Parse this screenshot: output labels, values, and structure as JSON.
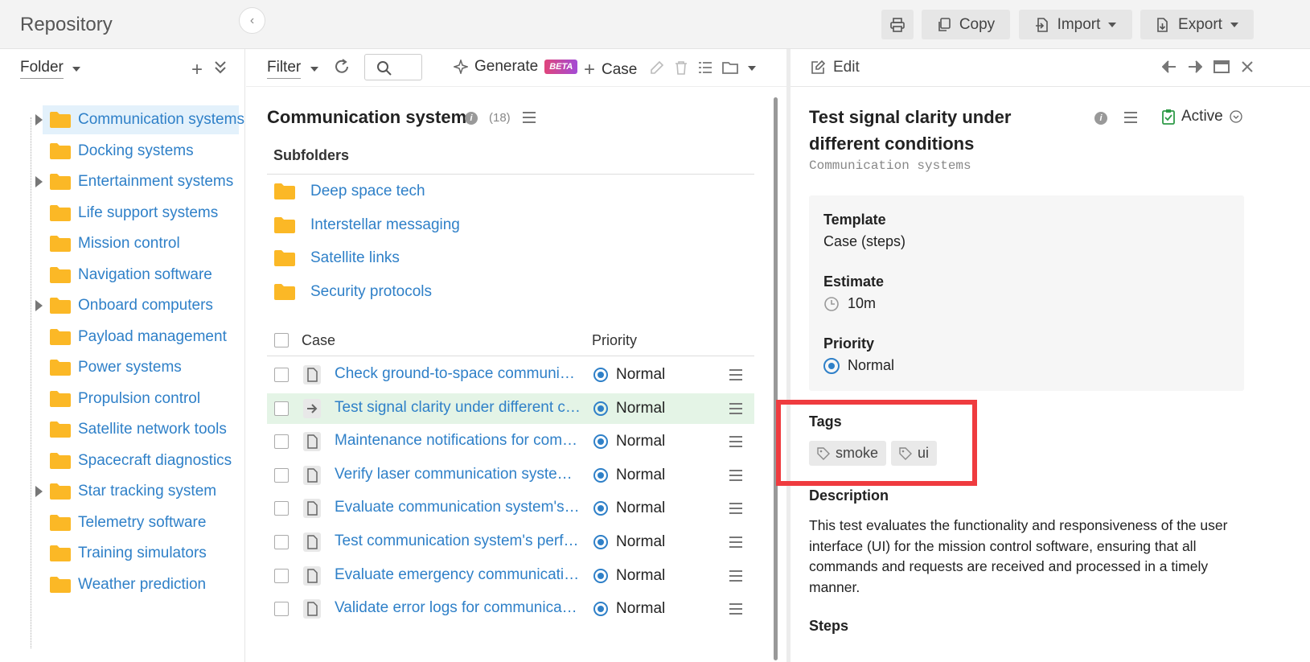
{
  "header": {
    "title": "Repository",
    "buttons": {
      "copy": "Copy",
      "import": "Import",
      "export": "Export"
    }
  },
  "left": {
    "folder_dropdown": "Folder",
    "items": [
      {
        "label": "Communication systems",
        "expandable": true,
        "selected": true
      },
      {
        "label": "Docking systems",
        "expandable": false
      },
      {
        "label": "Entertainment systems",
        "expandable": true
      },
      {
        "label": "Life support systems",
        "expandable": false
      },
      {
        "label": "Mission control",
        "expandable": false
      },
      {
        "label": "Navigation software",
        "expandable": false
      },
      {
        "label": "Onboard computers",
        "expandable": true
      },
      {
        "label": "Payload management",
        "expandable": false
      },
      {
        "label": "Power systems",
        "expandable": false
      },
      {
        "label": "Propulsion control",
        "expandable": false
      },
      {
        "label": "Satellite network tools",
        "expandable": false
      },
      {
        "label": "Spacecraft diagnostics",
        "expandable": false
      },
      {
        "label": "Star tracking system",
        "expandable": true
      },
      {
        "label": "Telemetry software",
        "expandable": false
      },
      {
        "label": "Training simulators",
        "expandable": false
      },
      {
        "label": "Weather prediction",
        "expandable": false
      }
    ]
  },
  "middle": {
    "filter_label": "Filter",
    "generate_label": "Generate",
    "beta_badge": "BETA",
    "case_button": "Case",
    "title": "Communication systems",
    "count": "(18)",
    "subfolders_heading": "Subfolders",
    "subfolders": [
      "Deep space tech",
      "Interstellar messaging",
      "Satellite links",
      "Security protocols"
    ],
    "columns": {
      "case": "Case",
      "priority": "Priority"
    },
    "rows": [
      {
        "title": "Check ground-to-space communication",
        "priority": "Normal",
        "selected": false
      },
      {
        "title": "Test signal clarity under different conditions",
        "priority": "Normal",
        "selected": true
      },
      {
        "title": "Maintenance notifications for communication",
        "priority": "Normal",
        "selected": false
      },
      {
        "title": "Verify laser communication system efficiency",
        "priority": "Normal",
        "selected": false
      },
      {
        "title": "Evaluate communication system's response",
        "priority": "Normal",
        "selected": false
      },
      {
        "title": "Test communication system's performance",
        "priority": "Normal",
        "selected": false
      },
      {
        "title": "Evaluate emergency communication protocols",
        "priority": "Normal",
        "selected": false
      },
      {
        "title": "Validate error logs for communication",
        "priority": "Normal",
        "selected": false
      }
    ]
  },
  "detail": {
    "edit_label": "Edit",
    "title": "Test signal clarity under different conditions",
    "folder": "Communication systems",
    "status": "Active",
    "fields": {
      "template_label": "Template",
      "template_value": "Case (steps)",
      "estimate_label": "Estimate",
      "estimate_value": "10m",
      "priority_label": "Priority",
      "priority_value": "Normal"
    },
    "tags_label": "Tags",
    "tags": [
      "smoke",
      "ui"
    ],
    "description_label": "Description",
    "description": "This test evaluates the functionality and responsiveness of the user interface (UI) for the mission control software, ensuring that all commands and requests are received and processed in a timely manner.",
    "steps_label": "Steps"
  },
  "colors": {
    "link": "#2f80c8",
    "highlight": "#ef3b3f",
    "folder": "#fbb826",
    "selected_row": "#e4f4e6"
  }
}
